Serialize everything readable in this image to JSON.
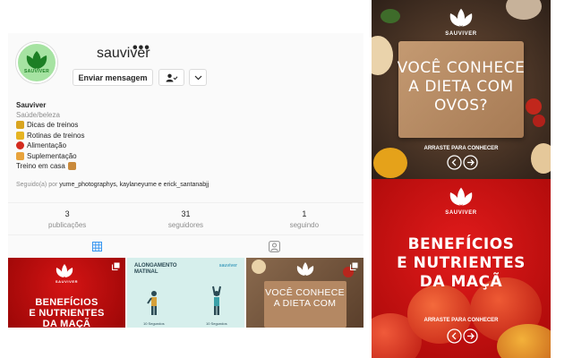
{
  "profile": {
    "username": "sauviver",
    "more_label": "•••",
    "message_button": "Enviar mensagem",
    "avatar_text": "SAUVIVER",
    "bio": {
      "name": "Sauviver",
      "category": "Saúde/beleza",
      "lines": [
        "Dicas de treinos",
        "Rotinas de treinos",
        "Alimentação",
        "Suplementação",
        "Treino em casa"
      ]
    },
    "followed_by_prefix": "Seguido(a) por",
    "followed_by_names": "yume_photographys, kaylaneyume e erick_santanabjj"
  },
  "stats": [
    {
      "value": "3",
      "label": "publicações"
    },
    {
      "value": "31",
      "label": "seguidores"
    },
    {
      "value": "1",
      "label": "seguindo"
    }
  ],
  "tabs": {
    "posts_icon": "grid-icon",
    "tagged_icon": "tagged-icon"
  },
  "grid": {
    "cell1_title": "BENEFÍCIOS\nE NUTRIENTES\nDA MAÇÃ",
    "cell1_brand": "SAUVIVER",
    "cell2_title": "ALONGAMENTO\nMATINAL",
    "cell2_brand": "sauviver",
    "cell2_caption_a": "10 Segundos",
    "cell2_caption_b": "10 Segundos",
    "cell3_title": "VOCÊ CONHECE\nA DIETA COM"
  },
  "posts": [
    {
      "brand": "SAUVIVER",
      "headline": "VOCÊ CONHECE\nA DIETA COM\nOVOS?",
      "swipe": "ARRASTE PARA CONHECER"
    },
    {
      "brand": "SAUVIVER",
      "headline": "BENEFÍCIOS\nE NUTRIENTES\nDA MAÇÃ",
      "swipe": "ARRASTE PARA CONHECER"
    }
  ],
  "colors": {
    "accent_red": "#c40d0d",
    "avatar_green": "#a6e3a2",
    "logo_green": "#1c7f24",
    "link_blue": "#3897f0"
  }
}
